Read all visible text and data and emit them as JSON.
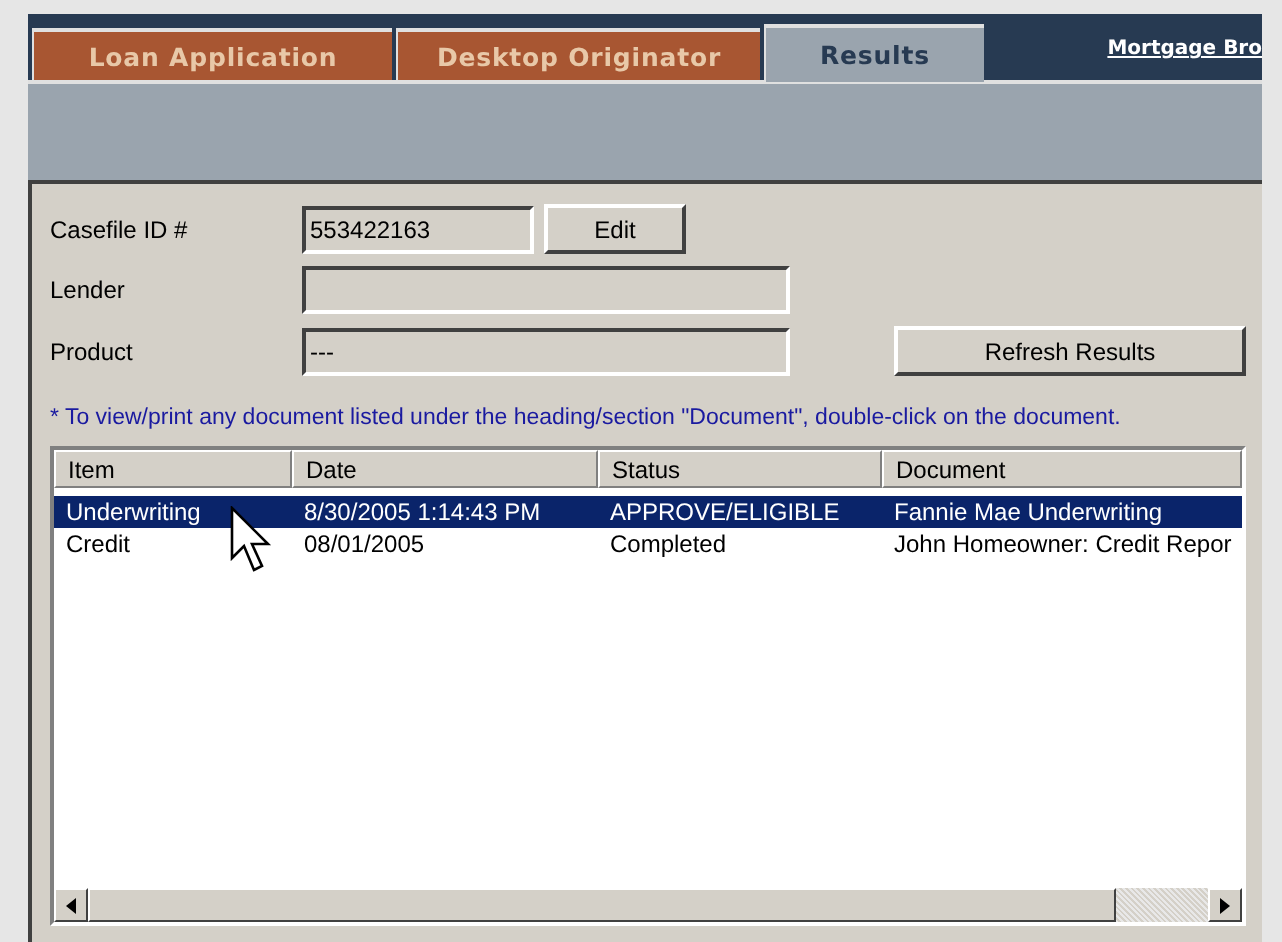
{
  "tabs": [
    {
      "label": "Loan Application",
      "selected": false
    },
    {
      "label": "Desktop Originator",
      "selected": false
    },
    {
      "label": "Results",
      "selected": true
    }
  ],
  "header_link": "Mortgage Bro",
  "form": {
    "casefile_label": "Casefile ID #",
    "casefile_value": "553422163",
    "edit_button": "Edit",
    "lender_label": "Lender",
    "product_label": "Product",
    "product_value": "---",
    "refresh_button": "Refresh Results"
  },
  "note": "* To view/print any document listed under the heading/section \"Document\", double-click on the document.",
  "table": {
    "columns": [
      "Item",
      "Date",
      "Status",
      "Document"
    ],
    "rows": [
      {
        "cells": [
          "Underwriting",
          "8/30/2005 1:14:43 PM",
          "APPROVE/ELIGIBLE",
          "Fannie Mae Underwriting"
        ],
        "selected": true
      },
      {
        "cells": [
          "Credit",
          "08/01/2005",
          "Completed",
          "John Homeowner: Credit Repor"
        ],
        "selected": false
      }
    ]
  }
}
